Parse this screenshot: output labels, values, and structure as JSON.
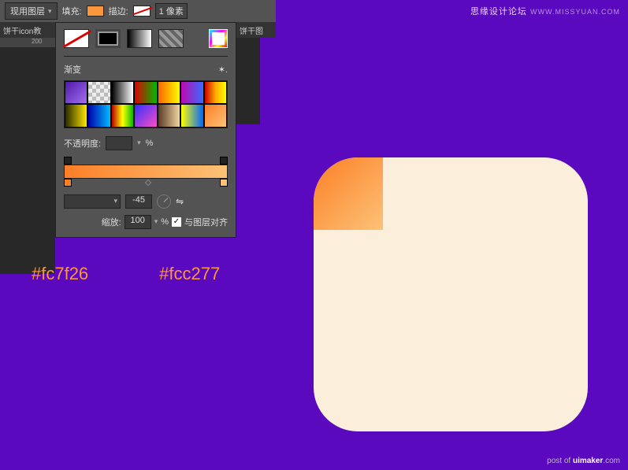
{
  "toolbar": {
    "layer_mode": "现用图层",
    "fill_label": "填充:",
    "stroke_label": "描边:",
    "stroke_width": "1 像素"
  },
  "tabs": {
    "left": "饼干icon教",
    "right": "饼干图"
  },
  "ruler": {
    "tick": "200"
  },
  "gradient_panel": {
    "title": "渐变",
    "opacity_label": "不透明度:",
    "opacity_unit": "%",
    "angle_value": "-45",
    "scale_label": "缩放:",
    "scale_value": "100",
    "scale_unit": "%",
    "align_label": "与图层对齐",
    "align_checked": "✓"
  },
  "hex": {
    "left": "#fc7f26",
    "right": "#fcc277"
  },
  "watermark": {
    "top_cn": "思缘设计论坛",
    "top_en": "WWW.MISSYUAN.COM",
    "bottom_prefix": "post of ",
    "bottom_site": "uimaker",
    "bottom_suffix": ".com"
  },
  "preset_gradients": [
    "linear-gradient(135deg,#4e1aa8,#a26ef0)",
    "repeating-conic-gradient(#bbb 0 25%,#eee 0 50%) 0/10px 10px",
    "linear-gradient(90deg,#000,#fff)",
    "linear-gradient(90deg,#d00,#0b0)",
    "linear-gradient(90deg,#f60,#ff0)",
    "linear-gradient(90deg,#c008b0,#3a6bff)",
    "linear-gradient(90deg,#c00,#fa0,#ff0)",
    "linear-gradient(90deg,#2a2a00,#ffe600)",
    "linear-gradient(90deg,#00a,#0bf)",
    "linear-gradient(90deg,#b00,#ff0,#0b0)",
    "linear-gradient(135deg,#2f2fff,#ff4dc3)",
    "linear-gradient(90deg,#5a3c28,#f2d5a0)",
    "linear-gradient(90deg,#ff0,#06f)",
    "linear-gradient(135deg,#fc7f26,#fcc277)"
  ]
}
